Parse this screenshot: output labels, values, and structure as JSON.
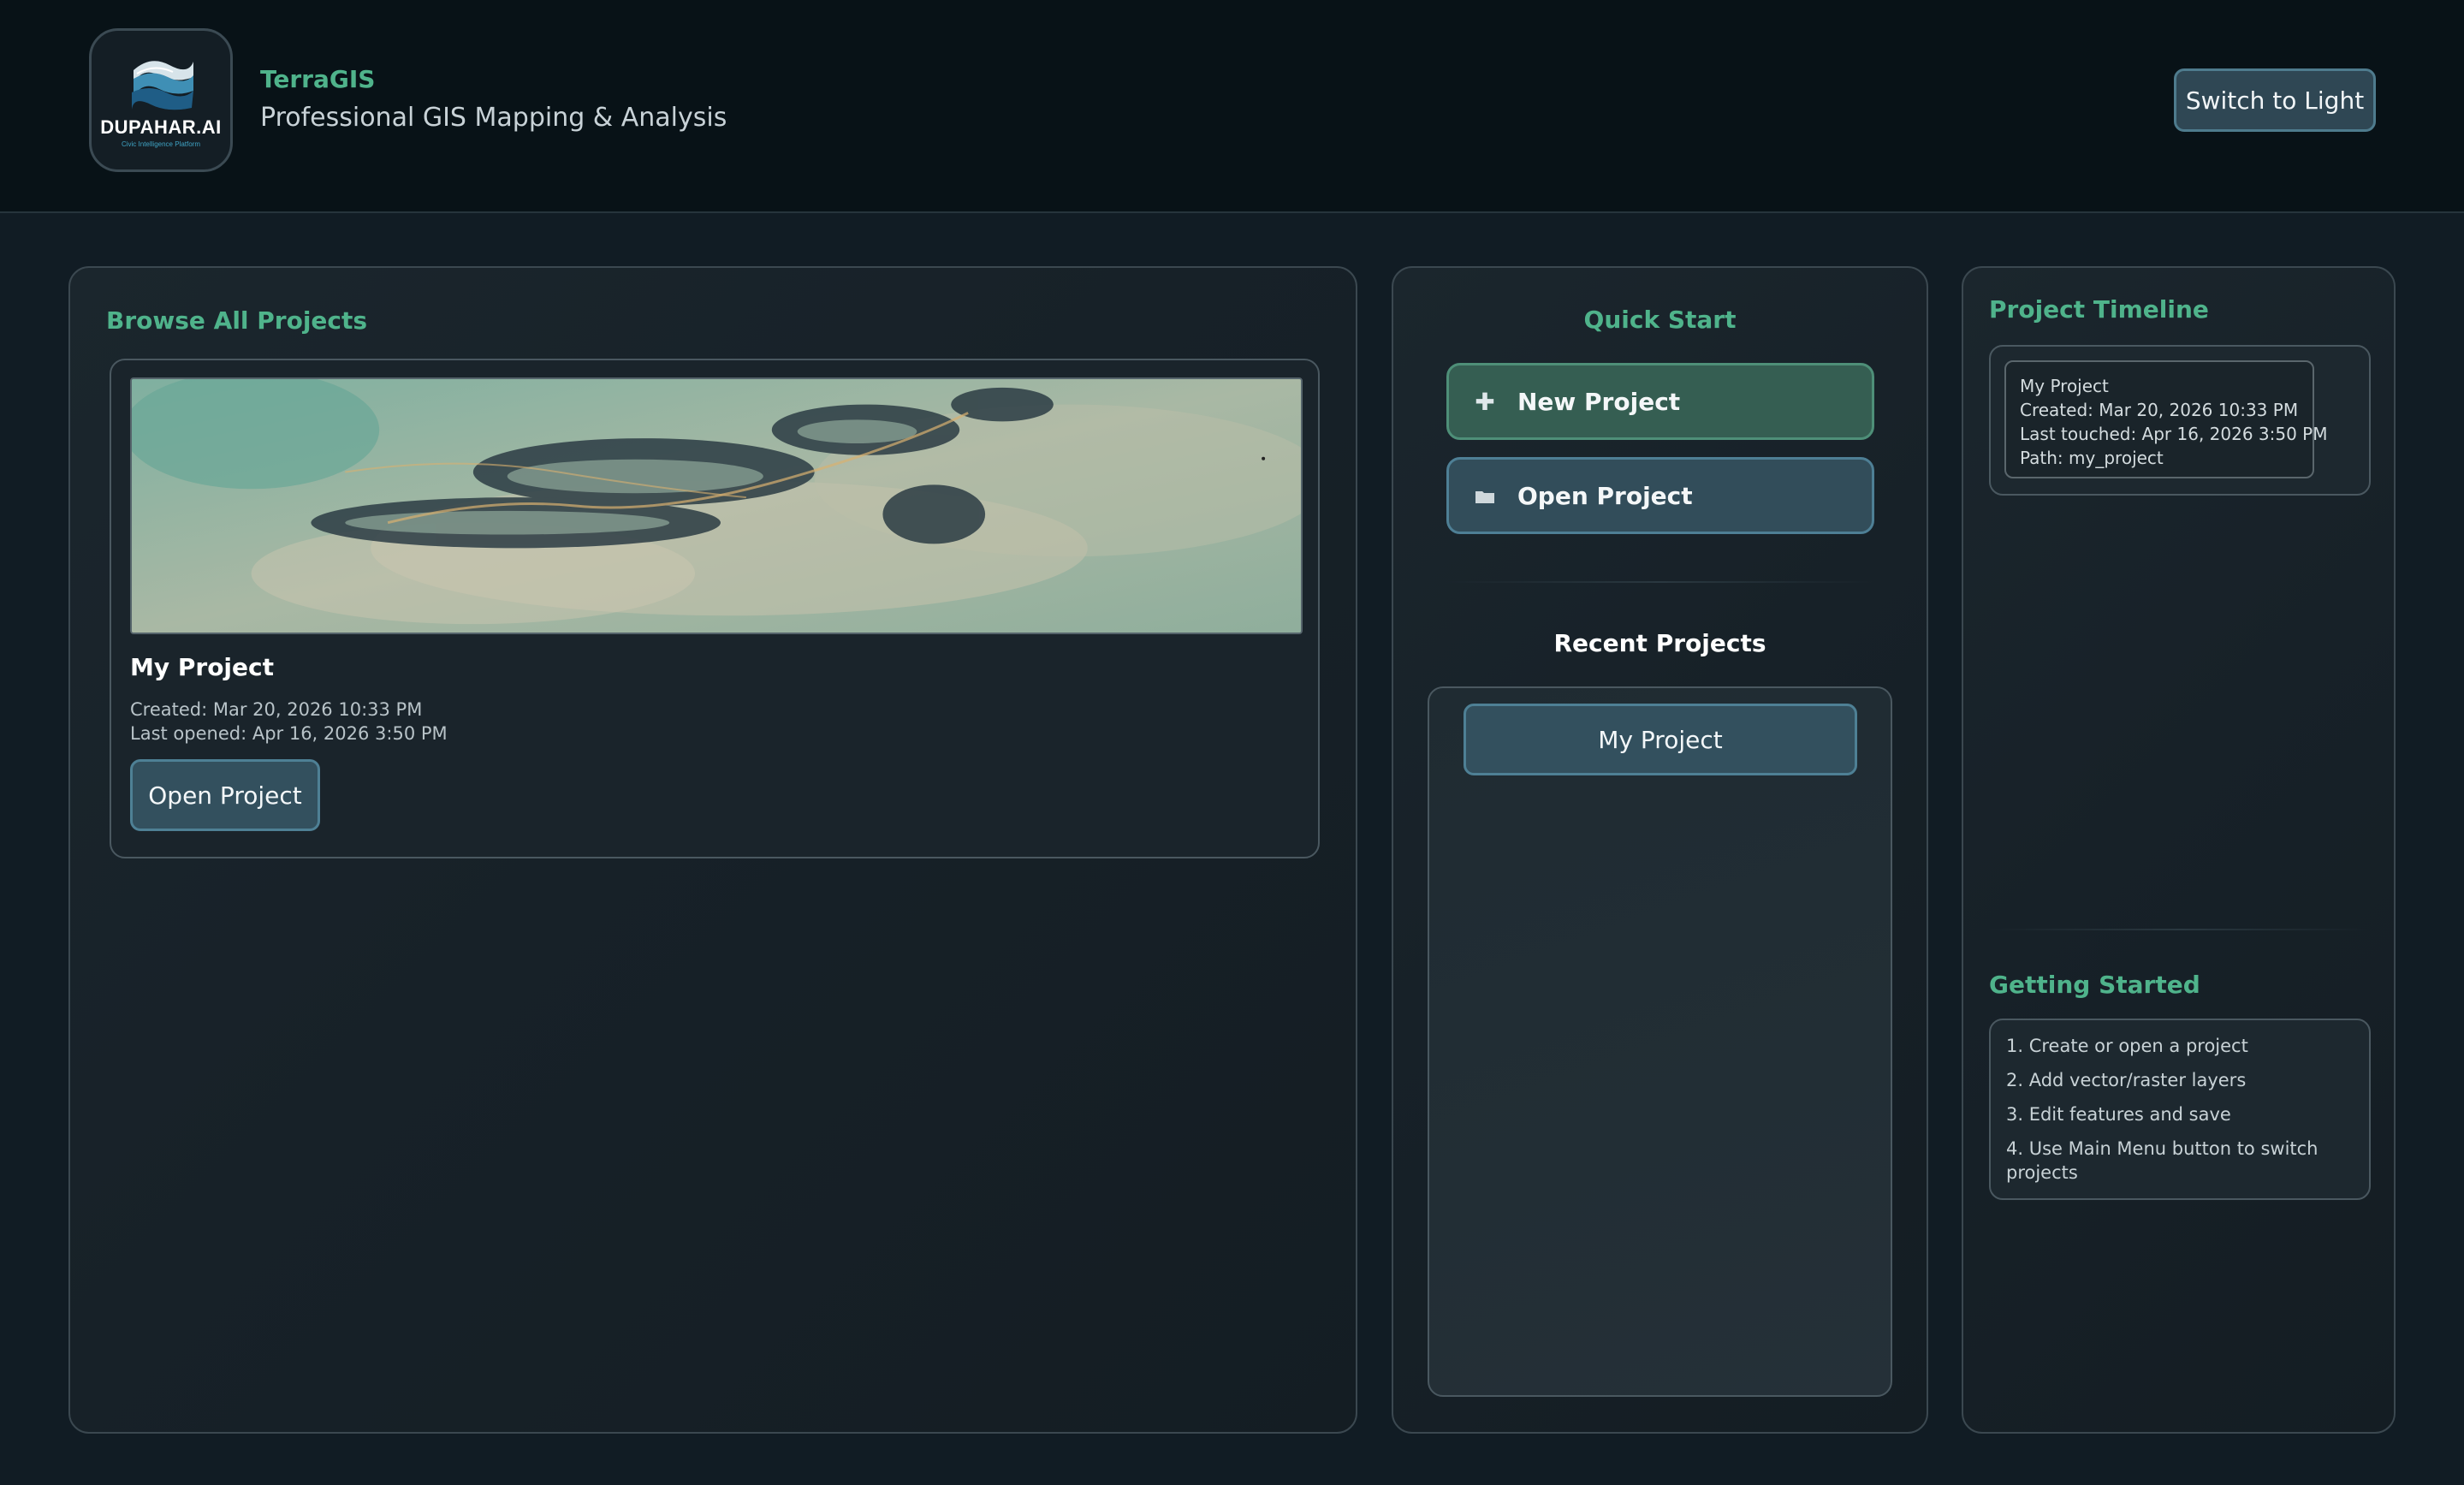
{
  "header": {
    "logo_text": "DUPAHAR.AI",
    "logo_subtext": "Civic Intelligence Platform",
    "app_title": "TerraGIS",
    "app_subtitle": "Professional GIS Mapping & Analysis",
    "theme_toggle_label": "Switch to Light"
  },
  "browse": {
    "title": "Browse All Projects",
    "projects": [
      {
        "name": "My Project",
        "created": "Created: Mar 20, 2026 10:33 PM",
        "last_opened": "Last opened: Apr 16, 2026 3:50 PM",
        "open_label": "Open Project"
      }
    ]
  },
  "quick_start": {
    "title": "Quick Start",
    "new_project_label": "New Project",
    "new_project_icon": "plus-icon",
    "open_project_label": "Open Project",
    "open_project_icon": "folder-icon",
    "recent_title": "Recent Projects",
    "recent_items": [
      "My Project"
    ]
  },
  "timeline": {
    "title": "Project Timeline",
    "entries": [
      {
        "name": "My Project",
        "created": "Created: Mar 20, 2026 10:33 PM",
        "last_touched": "Last touched: Apr 16, 2026 3:50 PM",
        "path": "Path: my_project"
      }
    ]
  },
  "getting_started": {
    "title": "Getting Started",
    "steps": [
      "1. Create or open a project",
      "2. Add vector/raster layers",
      "3. Edit features and save",
      "4. Use Main Menu button to switch projects"
    ]
  },
  "colors": {
    "accent_green": "#4fb38b",
    "background": "#111c24",
    "button_blue": "#33505e"
  }
}
